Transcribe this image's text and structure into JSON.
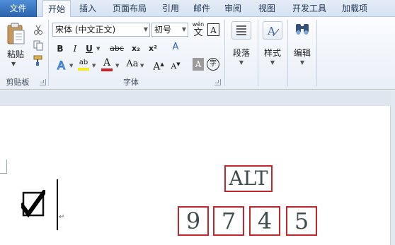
{
  "tabs": {
    "file": "文件",
    "home": "开始",
    "insert": "插入",
    "page_layout": "页面布局",
    "references": "引用",
    "mailings": "邮件",
    "review": "审阅",
    "view": "视图",
    "developer": "开发工具",
    "addins": "加载项"
  },
  "clipboard": {
    "paste_label": "粘贴",
    "group_label": "剪贴板"
  },
  "font": {
    "font_name": "宋体 (中文正文)",
    "font_size": "初号",
    "group_label": "字体",
    "bold": "B",
    "italic": "I",
    "underline": "U",
    "strikethrough": "abc",
    "subscript": "x₂",
    "superscript": "x²",
    "clear_format": "A",
    "highlight": "ab",
    "font_color": "A",
    "change_case": "Aa",
    "grow_font": "A",
    "shrink_font": "A",
    "phonetic": "wén",
    "phonetic_char": "文",
    "char_border": "A",
    "char_shading": "A",
    "enclose_char": "字"
  },
  "paragraph": {
    "label": "段落"
  },
  "styles": {
    "label": "样式"
  },
  "editing": {
    "label": "编辑"
  },
  "document": {
    "key_alt": "ALT",
    "keys": [
      "9",
      "7",
      "4",
      "5"
    ],
    "paragraph_mark": "↵"
  },
  "colors": {
    "file_tab": "#2a62ad",
    "key_border": "#c0262b",
    "font_color_bar": "#d21f1f",
    "highlight_bar": "#f4ea1e"
  }
}
